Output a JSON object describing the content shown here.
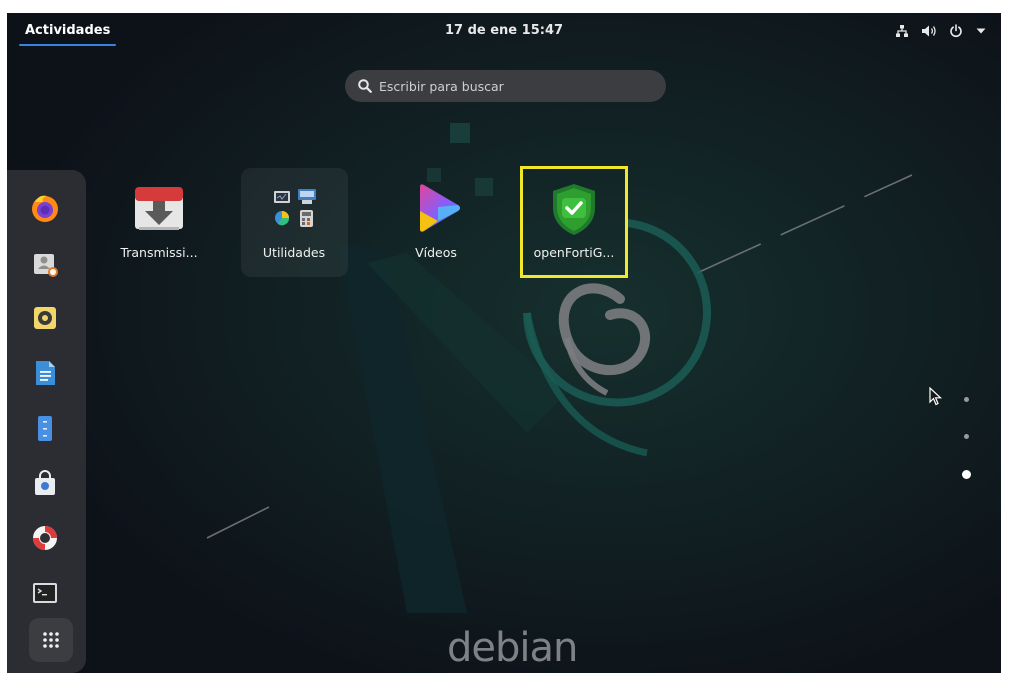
{
  "topbar": {
    "activities_label": "Actividades",
    "clock": "17 de ene 15:47",
    "status_icons": [
      "network-icon",
      "volume-icon",
      "power-icon",
      "chevron-down-icon"
    ]
  },
  "search": {
    "placeholder": "Escribir para buscar"
  },
  "dock": {
    "items": [
      {
        "name": "firefox",
        "icon": "firefox-icon"
      },
      {
        "name": "contacts",
        "icon": "contacts-icon"
      },
      {
        "name": "rhythmbox",
        "icon": "speaker-icon"
      },
      {
        "name": "writer",
        "icon": "document-icon"
      },
      {
        "name": "files",
        "icon": "file-cabinet-icon"
      },
      {
        "name": "software",
        "icon": "shopping-bag-icon"
      },
      {
        "name": "help",
        "icon": "lifebuoy-icon"
      },
      {
        "name": "terminal",
        "icon": "terminal-icon"
      }
    ],
    "show_apps": "apps-grid-icon"
  },
  "apps": [
    {
      "label": "Transmissi...",
      "icon": "transmission-icon"
    },
    {
      "label": "Utilidades",
      "icon": "utilities-folder-icon"
    },
    {
      "label": "Vídeos",
      "icon": "video-play-icon"
    },
    {
      "label": "openFortiG...",
      "icon": "shield-check-icon",
      "highlighted": true
    }
  ],
  "pages": {
    "count": 3,
    "current": 3
  },
  "wallpaper": {
    "brand": "debian"
  },
  "colors": {
    "accent": "#3584e4",
    "highlight": "#f2e82b",
    "background": "#0d1219",
    "shield": "#2e9e2e"
  }
}
